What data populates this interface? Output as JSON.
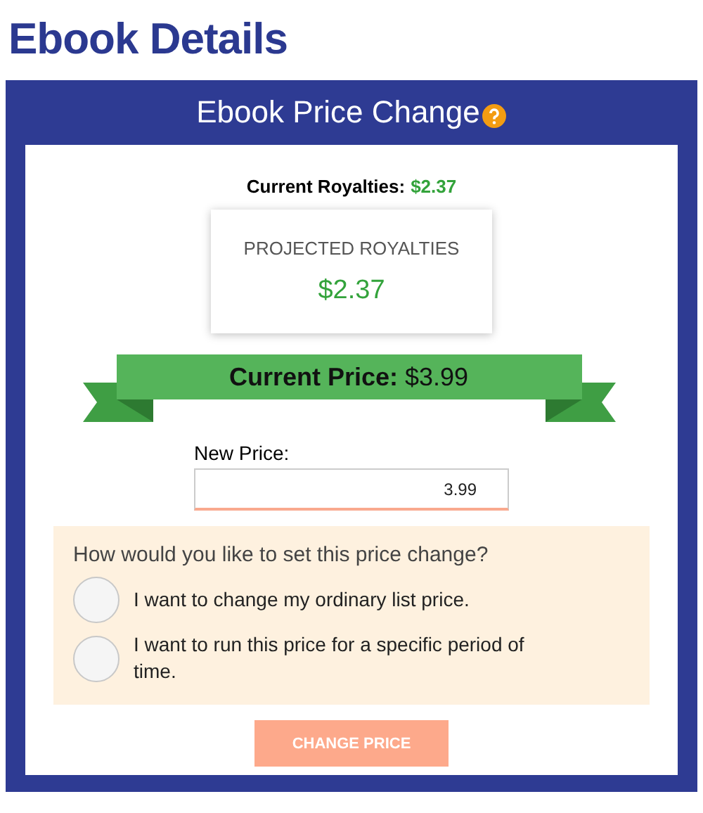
{
  "page_title": "Ebook Details",
  "panel": {
    "title": "Ebook Price Change",
    "current_royalties": {
      "label": "Current Royalties:",
      "value": "$2.37"
    },
    "projected_royalties": {
      "label": "PROJECTED ROYALTIES",
      "value": "$2.37"
    },
    "current_price": "**Current Price:** $3.99",
    "new_price": {
      "label": "New Price:",
      "value": "3.99"
    },
    "question": {
      "prompt": "How would you like to set this price change?",
      "options": [
        {
          "label": "I want to change my ordinary list price.",
          "selected": false
        },
        {
          "label": "I want to run this price for a specific period of time.",
          "selected": false
        }
      ]
    },
    "button": {
      "label": "CHANGE PRICE",
      "disabled": true
    }
  }
}
